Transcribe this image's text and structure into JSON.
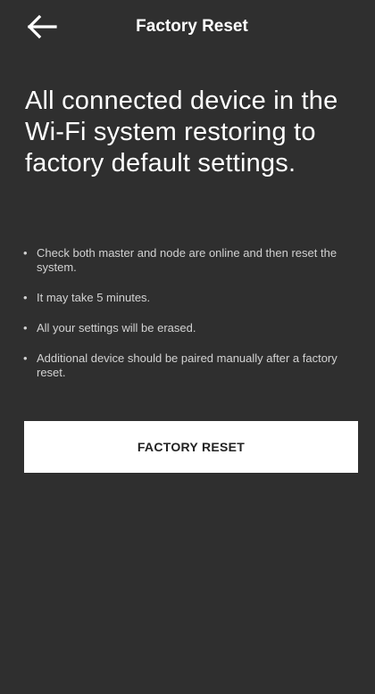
{
  "header": {
    "back_icon": "arrow-left-icon",
    "title": "Factory Reset"
  },
  "main": {
    "headline": "All connected device in the Wi-Fi system restoring to factory default settings.",
    "tips": [
      "Check both master and node are online and then reset the system.",
      "It may take 5 minutes.",
      "All your settings will be erased.",
      "Additional device should be paired manually after a factory reset."
    ],
    "button_label": "FACTORY RESET"
  },
  "colors": {
    "background": "#2f2f2f",
    "text": "#ffffff",
    "muted_text": "#d2d2d2",
    "button_background": "#ffffff",
    "button_text": "#222222"
  }
}
